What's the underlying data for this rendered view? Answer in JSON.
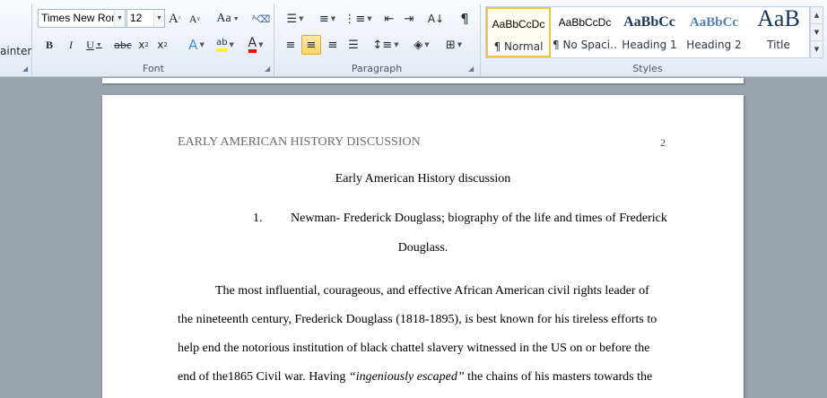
{
  "clipboard": {
    "painter_label": "ainter"
  },
  "font": {
    "family": "Times New Rom",
    "size": "12",
    "group_label": "Font"
  },
  "paragraph": {
    "group_label": "Paragraph"
  },
  "styles": {
    "group_label": "Styles",
    "items": [
      {
        "sample": "AaBbCcDc",
        "name": "¶ Normal"
      },
      {
        "sample": "AaBbCcDc",
        "name": "¶ No Spaci..."
      },
      {
        "sample": "AaBbCc",
        "name": "Heading 1"
      },
      {
        "sample": "AaBbCc",
        "name": "Heading 2"
      },
      {
        "sample": "AaB",
        "name": "Title"
      }
    ]
  },
  "document": {
    "running_head": "EARLY AMERICAN HISTORY DISCUSSION",
    "page_number": "2",
    "title": "Early American History discussion",
    "list_number": "1.",
    "list_line1": "Newman- Frederick Douglass; biography of the life and times of Frederick",
    "list_line2": "Douglass.",
    "para_lines": [
      "The most influential, courageous, and effective African American civil rights leader of",
      "the nineteenth century, Frederick Douglass (1818-1895), is best known for his tireless efforts to",
      "help end the notorious institution of black chattel slavery witnessed in the US on or before the"
    ],
    "last_line_start": "end of the1865 Civil war. Having ",
    "last_line_italic": "“ingeniously escaped”",
    "last_line_end": " the chains of his masters towards the"
  },
  "colors": {
    "highlight": "#ffff00",
    "font_color": "#ff0000",
    "heading_blue": "#17365d"
  }
}
